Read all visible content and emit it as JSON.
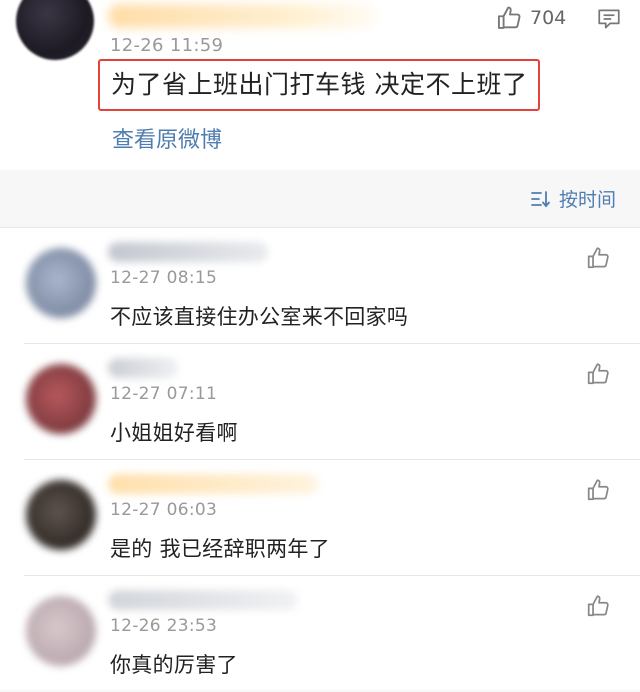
{
  "post": {
    "time": "12-26 11:59",
    "like_count": "704",
    "content": "为了省上班出门打车钱 决定不上班了",
    "view_origin": "查看原微博",
    "icons": {
      "like": "thumbs-up-icon",
      "comment": "comment-icon"
    }
  },
  "sort": {
    "label": "按时间",
    "icon": "sort-icon"
  },
  "comments": [
    {
      "time": "12-27 08:15",
      "text": "不应该直接住办公室来不回家吗"
    },
    {
      "time": "12-27 07:11",
      "text": "小姐姐好看啊"
    },
    {
      "time": "12-27 06:03",
      "text": "是的 我已经辞职两年了"
    },
    {
      "time": "12-26 23:53",
      "text": "你真的厉害了"
    }
  ],
  "colors": {
    "link": "#507daf",
    "highlight_border": "#e5403a",
    "secondary_text": "#999999",
    "page_background": "#f7f7f7"
  }
}
